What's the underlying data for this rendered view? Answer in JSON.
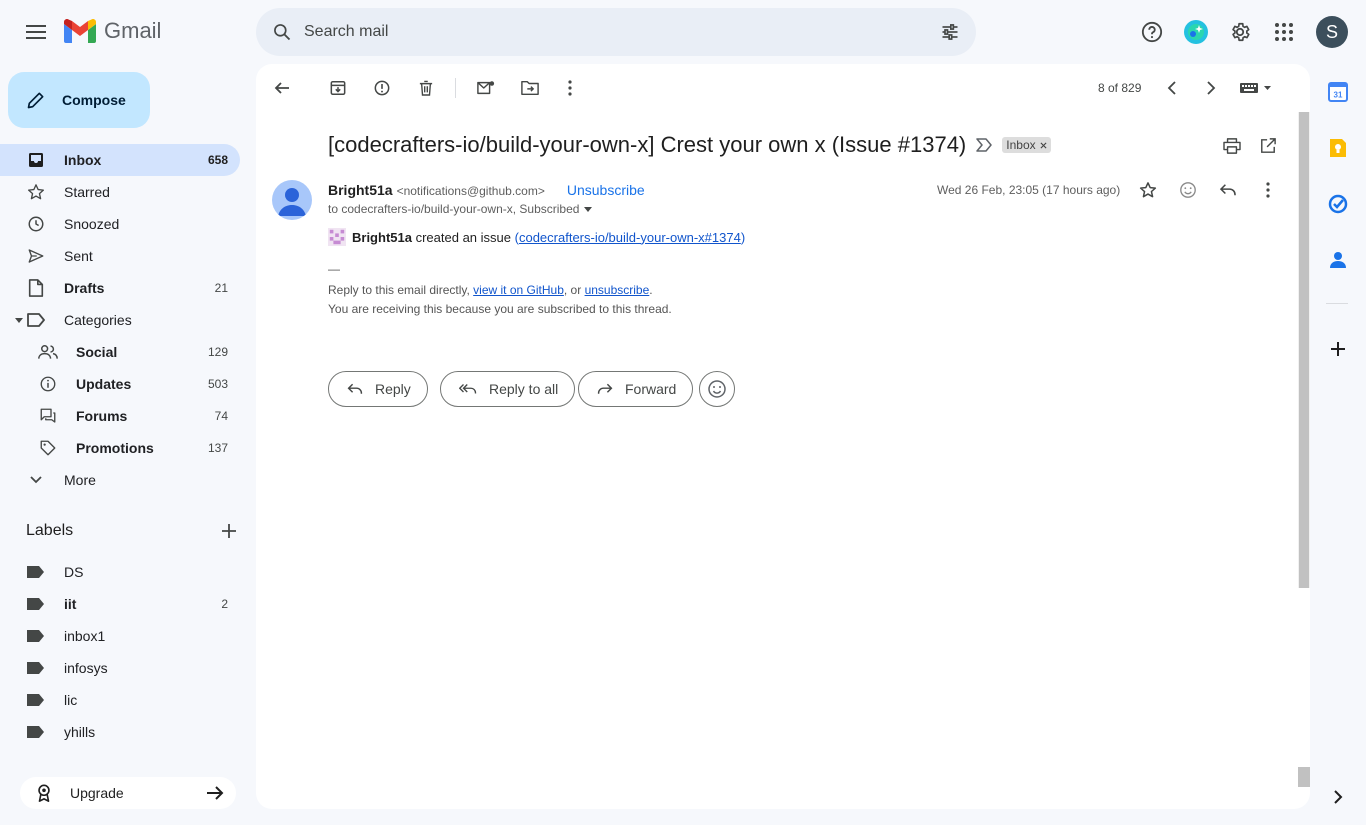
{
  "app": {
    "name": "Gmail"
  },
  "search": {
    "placeholder": "Search mail"
  },
  "account": {
    "initial": "S"
  },
  "compose": {
    "label": "Compose"
  },
  "nav": [
    {
      "label": "Inbox",
      "count": "658"
    },
    {
      "label": "Starred",
      "count": ""
    },
    {
      "label": "Snoozed",
      "count": ""
    },
    {
      "label": "Sent",
      "count": ""
    },
    {
      "label": "Drafts",
      "count": "21"
    },
    {
      "label": "Categories",
      "count": ""
    }
  ],
  "categories": [
    {
      "label": "Social",
      "count": "129"
    },
    {
      "label": "Updates",
      "count": "503"
    },
    {
      "label": "Forums",
      "count": "74"
    },
    {
      "label": "Promotions",
      "count": "137"
    }
  ],
  "more_label": "More",
  "labels": {
    "title": "Labels",
    "items": [
      {
        "label": "DS",
        "count": ""
      },
      {
        "label": "iit",
        "count": "2"
      },
      {
        "label": "inbox1",
        "count": ""
      },
      {
        "label": "infosys",
        "count": ""
      },
      {
        "label": "lic",
        "count": ""
      },
      {
        "label": "yhills",
        "count": ""
      }
    ]
  },
  "upgrade": {
    "label": "Upgrade"
  },
  "toolbar": {
    "pager": "8 of 829"
  },
  "email": {
    "subject": "[codecrafters-io/build-your-own-x] Crest your own x (Issue #1374)",
    "tag": "Inbox",
    "sender_name": "Bright51a",
    "sender_email": "<notifications@github.com>",
    "unsubscribe": "Unsubscribe",
    "to": "to codecrafters-io/build-your-own-x, Subscribed",
    "date": "Wed 26 Feb, 23:05 (17 hours ago)",
    "body_user": "Bright51a",
    "body_text": "created an issue",
    "body_link_open": "(",
    "body_link": "codecrafters-io/build-your-own-x#1374",
    "body_link_close": ")",
    "dash": "—",
    "footer1_pre": "Reply to this email directly,",
    "footer1_link1": "view it on GitHub",
    "footer1_mid": ", or",
    "footer1_link2": "unsubscribe",
    "footer1_end": ".",
    "footer2": "You are receiving this because you are subscribed to this thread."
  },
  "actions": {
    "reply": "Reply",
    "reply_all": "Reply to all",
    "forward": "Forward"
  }
}
